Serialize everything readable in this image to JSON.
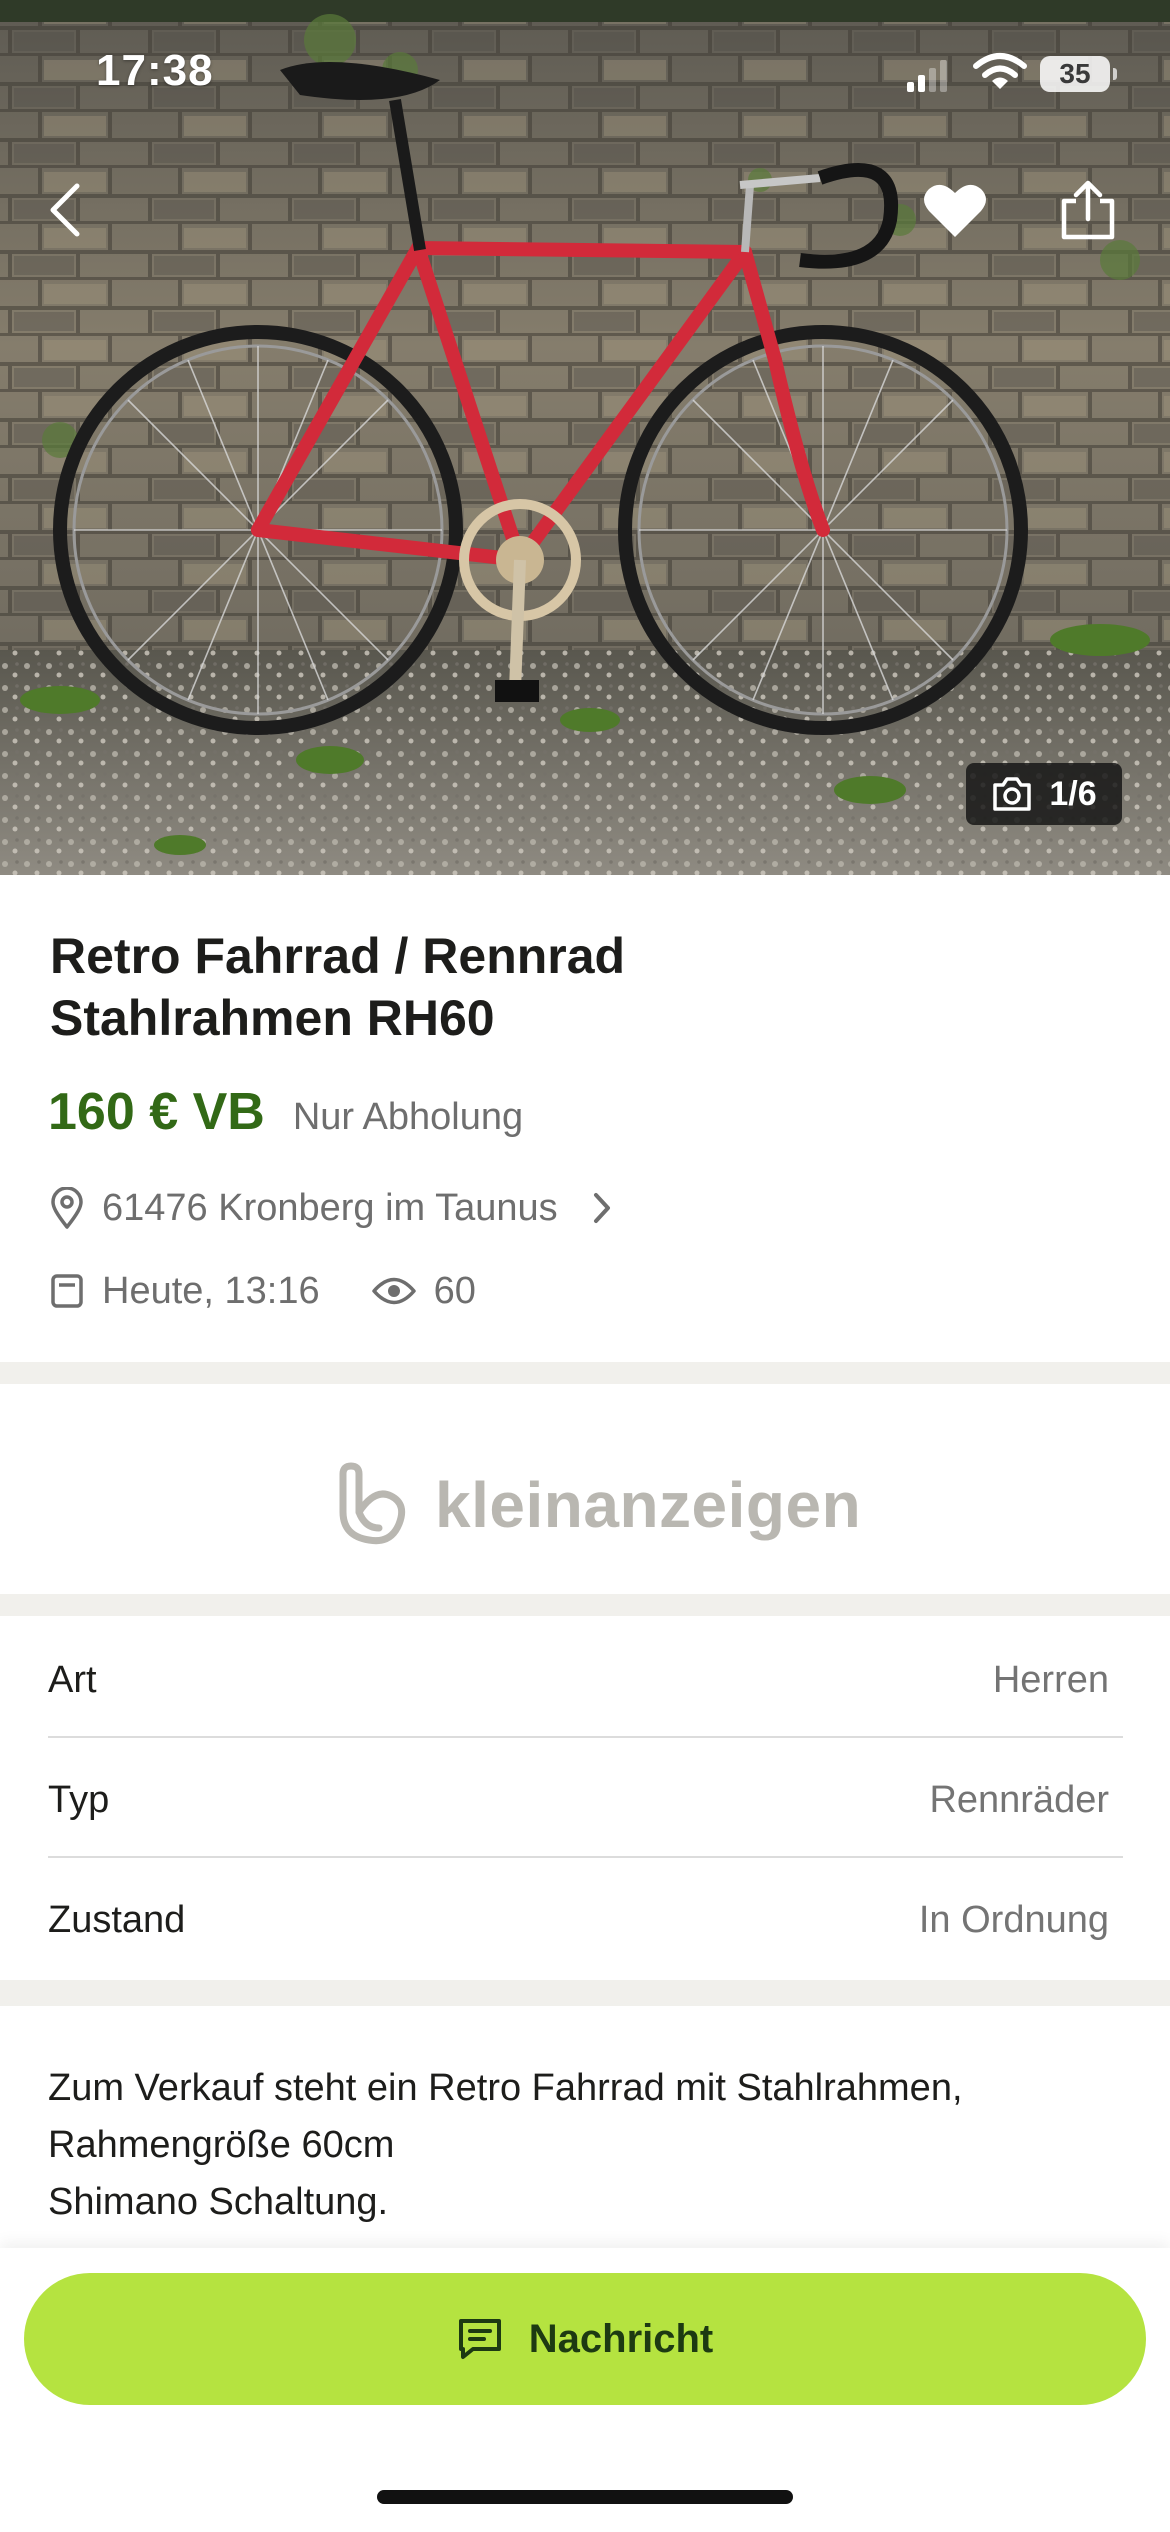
{
  "status_bar": {
    "time": "17:38",
    "battery": "35"
  },
  "hero": {
    "photo_counter": "1/6",
    "icons": [
      "back-icon",
      "heart-icon",
      "share-icon",
      "camera-icon"
    ]
  },
  "listing": {
    "title_line1": "Retro Fahrrad / Rennrad",
    "title_line2": "Stahlrahmen RH60",
    "price": "160 € VB",
    "shipping": "Nur Abholung",
    "location": "61476 Kronberg im Taunus",
    "posted": "Heute, 13:16",
    "views": "60"
  },
  "brand": {
    "logo_text": "kleinanzeigen"
  },
  "attributes": [
    {
      "label": "Art",
      "value": "Herren"
    },
    {
      "label": "Typ",
      "value": "Rennräder"
    },
    {
      "label": "Zustand",
      "value": "In Ordnung"
    }
  ],
  "description": {
    "line1": "Zum Verkauf steht ein Retro Fahrrad mit Stahlrahmen,",
    "line2": "Rahmengröße 60cm",
    "line3": "Shimano Schaltung."
  },
  "actions": {
    "message_label": "Nachricht"
  },
  "colors": {
    "price": "#326916",
    "cta": "#b5e340",
    "muted": "#6e6e6e"
  }
}
